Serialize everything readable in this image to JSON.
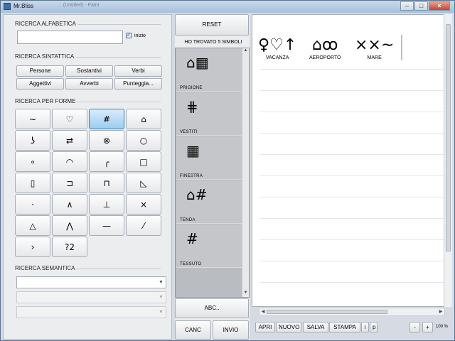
{
  "window": {
    "title": "Mr.Bliss",
    "ghost_text": "... (Untitled) - Paint"
  },
  "alpha_search": {
    "title": "RICERCA ALFABETICA",
    "value": "",
    "checkbox_label": "inizio",
    "checked": true
  },
  "syntax_search": {
    "title": "RICERCA SINTATTICA",
    "buttons": [
      "Persone",
      "Sostantivi",
      "Verbi",
      "Aggettivi",
      "Avverbi",
      "Punteggia..."
    ]
  },
  "shape_search": {
    "title": "RICERCA PER FORME",
    "shapes": [
      {
        "glyph": "∼",
        "icon": "tilde-icon"
      },
      {
        "glyph": "♡",
        "icon": "heart-icon"
      },
      {
        "glyph": "#",
        "icon": "grid-icon"
      },
      {
        "glyph": "⌂",
        "icon": "house-icon"
      },
      {
        "glyph": "ʖ",
        "icon": "hook-icon"
      },
      {
        "glyph": "⇄",
        "icon": "double-arrow-icon"
      },
      {
        "glyph": "⊗",
        "icon": "circled-x-icon"
      },
      {
        "glyph": "○",
        "icon": "circle-icon"
      },
      {
        "glyph": "∘",
        "icon": "small-circle-icon"
      },
      {
        "glyph": "◠",
        "icon": "arc-icon"
      },
      {
        "glyph": "╭",
        "icon": "corner-arc-icon"
      },
      {
        "glyph": "□",
        "icon": "square-icon"
      },
      {
        "glyph": "▯",
        "icon": "rectangle-icon"
      },
      {
        "glyph": "⊐",
        "icon": "bracket-icon"
      },
      {
        "glyph": "⊓",
        "icon": "cap-icon"
      },
      {
        "glyph": "◺",
        "icon": "right-triangle-icon"
      },
      {
        "glyph": "·",
        "icon": "dot-icon"
      },
      {
        "glyph": "∧",
        "icon": "caret-icon"
      },
      {
        "glyph": "⊥",
        "icon": "perpendicular-icon"
      },
      {
        "glyph": "×",
        "icon": "cross-icon"
      },
      {
        "glyph": "△",
        "icon": "triangle-icon"
      },
      {
        "glyph": "⋀",
        "icon": "big-caret-icon"
      },
      {
        "glyph": "—",
        "icon": "line-icon"
      },
      {
        "glyph": "⁄",
        "icon": "slash-icon"
      },
      {
        "glyph": "›",
        "icon": "angle-right-icon"
      },
      {
        "glyph": "?2",
        "icon": "question-icon"
      }
    ],
    "selected": 2
  },
  "semantic_search": {
    "title": "RICERCA SEMANTICA",
    "combos": [
      "",
      "",
      ""
    ]
  },
  "middle": {
    "reset_label": "RESET",
    "found_label": "HO TROVATO 5 SIMBOLI",
    "results": [
      {
        "symbol": "⌂▦",
        "word": "PRIGIONE"
      },
      {
        "symbol": "⋕",
        "word": "VESTITI"
      },
      {
        "symbol": "▦",
        "word": "FINESTRA"
      },
      {
        "symbol": "⌂#",
        "word": "TENDA"
      },
      {
        "symbol": "#",
        "word": "TESSUTO"
      }
    ],
    "abc_label": "ABC..",
    "canc_label": "CANC",
    "invio_label": "INVIO"
  },
  "canvas": {
    "words": [
      {
        "symbol": "♀♡↑",
        "word": "VACANZA"
      },
      {
        "symbol": "⌂ꝏ",
        "word": "AEROPORTO"
      },
      {
        "symbol": "××∼",
        "word": "MARE"
      }
    ]
  },
  "toolbar": {
    "buttons": [
      "APRI",
      "NUOVO",
      "SALVA",
      "STAMPA",
      "i",
      "p"
    ],
    "zoom_minus": "-",
    "zoom_plus": "+",
    "zoom_value": "100 %"
  }
}
